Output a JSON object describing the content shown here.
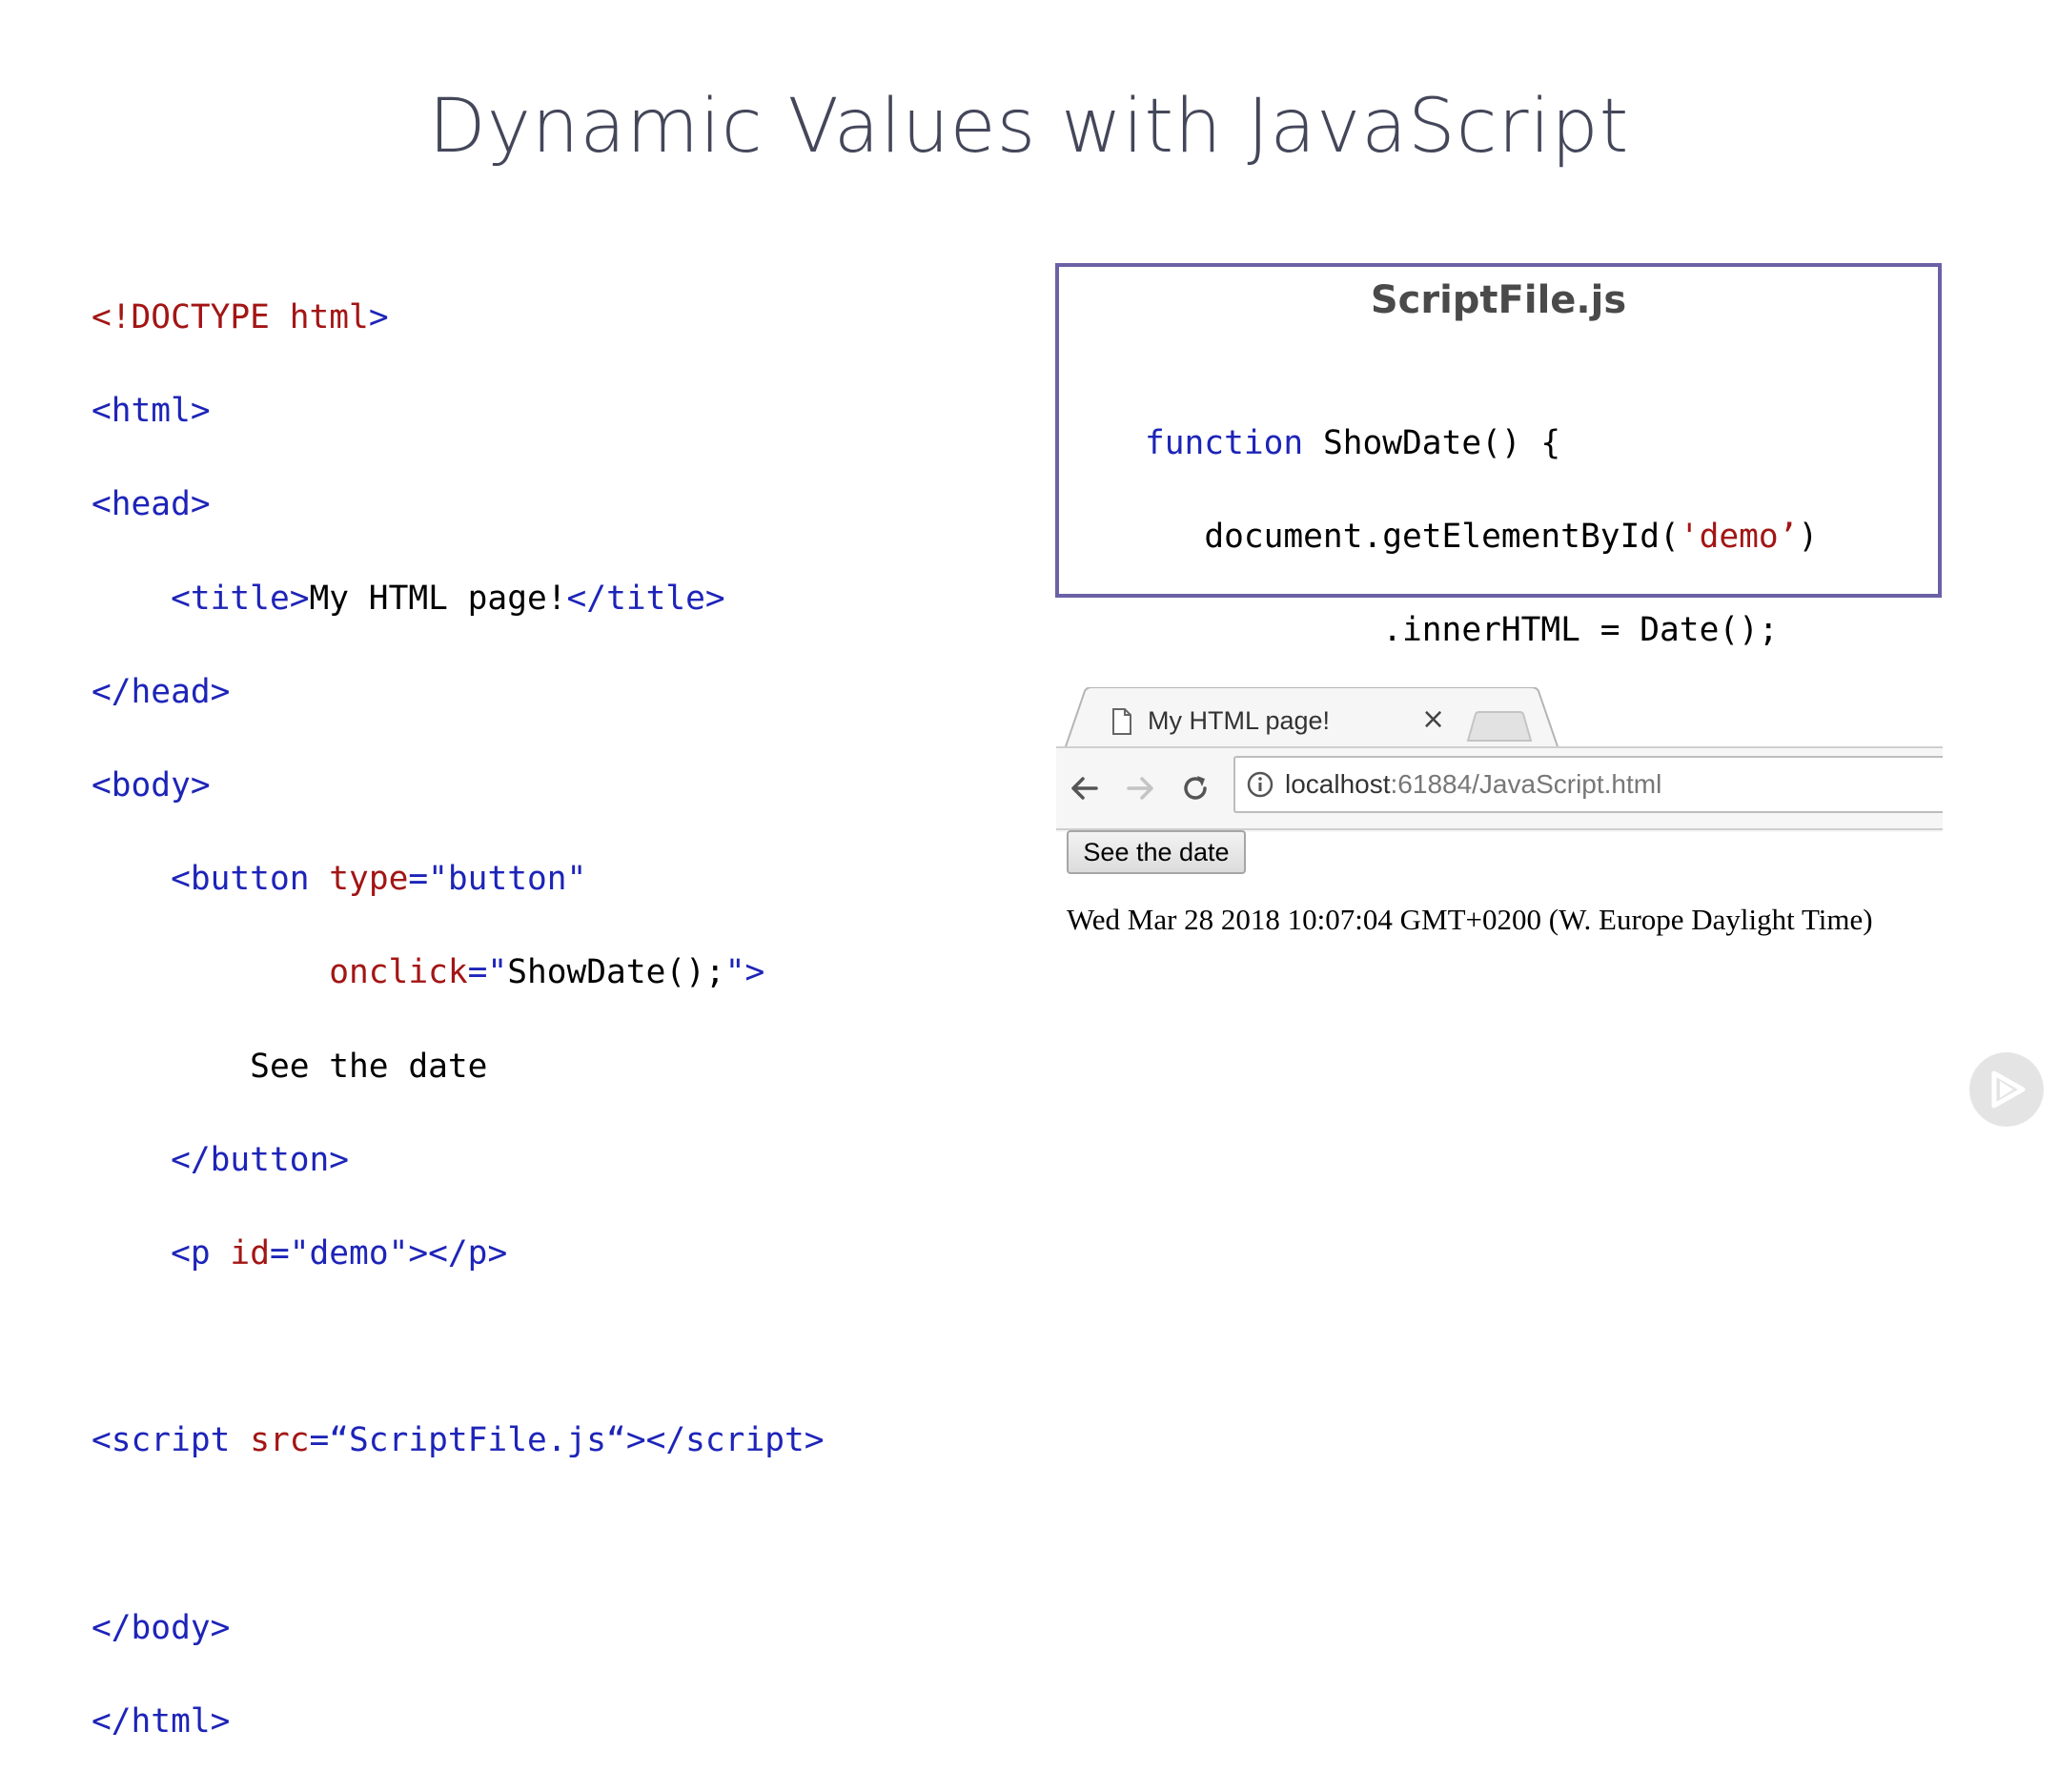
{
  "slide": {
    "title": "Dynamic Values with JavaScript"
  },
  "html_code": {
    "l1_a": "<!DOCTYPE",
    "l1_b": "html",
    "l1_c": ">",
    "l2": "<html>",
    "l3": "<head>",
    "l4_a": "<title>",
    "l4_b": "My HTML page!",
    "l4_c": "</title>",
    "l5": "</head>",
    "l6": "<body>",
    "l7_a": "<button",
    "l7_b": "type",
    "l7_c": "=\"button\"",
    "l8_a": "onclick",
    "l8_b": "=\"",
    "l8_c": "ShowDate();",
    "l8_d": "\">",
    "l9": "See the date",
    "l10": "</button>",
    "l11_a": "<p",
    "l11_b": "id",
    "l11_c": "=\"demo\"></p>",
    "l12_a": "<script",
    "l12_b": "src",
    "l12_c": "=“ScriptFile.js“></script>",
    "l13": "</body>",
    "l14": "</html>"
  },
  "script_file": {
    "title": "ScriptFile.js",
    "l1_a": "function",
    "l1_b": " ShowDate() {",
    "l2_a": "document.getElementById(",
    "l2_b": "'demo’",
    "l2_c": ")",
    "l3": ".innerHTML = Date();",
    "l4": "}"
  },
  "browser": {
    "tab_title": "My HTML page!",
    "tab_close": "×",
    "url_host": "localhost",
    "url_path": ":61884/JavaScript.html",
    "button_label": "See the date",
    "output_text": "Wed Mar 28 2018 10:07:04 GMT+0200 (W. Europe Daylight Time)"
  },
  "icons": {
    "back": "arrow-left-icon",
    "forward": "arrow-right-icon",
    "reload": "reload-icon",
    "info": "info-icon",
    "page": "page-icon",
    "logo": "play-logo-icon"
  },
  "colors": {
    "tag_blue": "#1d24b8",
    "attr_red": "#a31515",
    "box_border": "#6a61a6",
    "title_gray": "#44475a"
  }
}
